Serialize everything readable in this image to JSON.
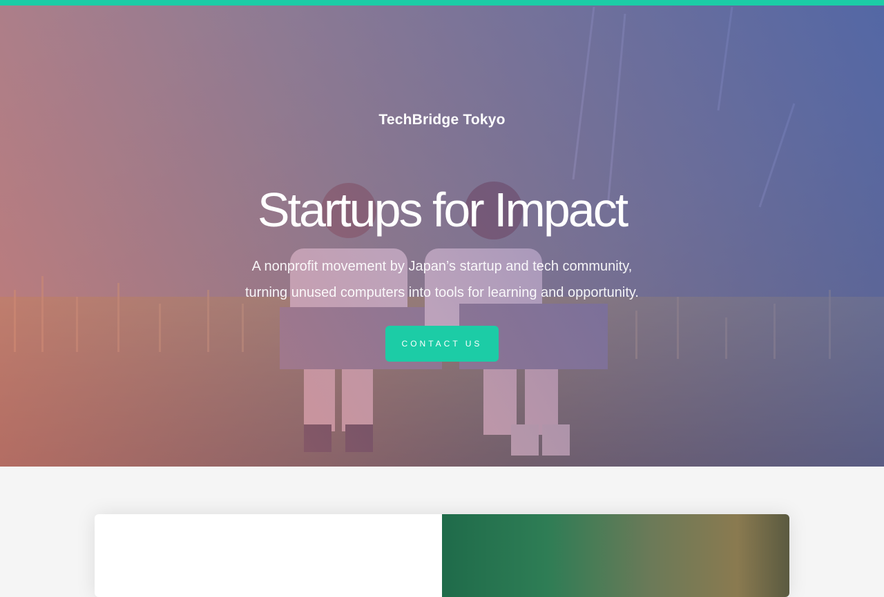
{
  "hero": {
    "brand": "TechBridge Tokyo",
    "headline": "Startups for Impact",
    "subline_1": "A nonprofit movement by Japan’s startup and tech community,",
    "subline_2": "turning unused computers into tools for learning and opportunity.",
    "cta_label": "CONTACT US",
    "background": "photo of two children sitting in grass using laptops"
  },
  "colors": {
    "accent": "#1ccca6",
    "overlay_start": "#e07a78",
    "overlay_end": "#4a60b2",
    "page_bg": "#f5f5f5"
  }
}
